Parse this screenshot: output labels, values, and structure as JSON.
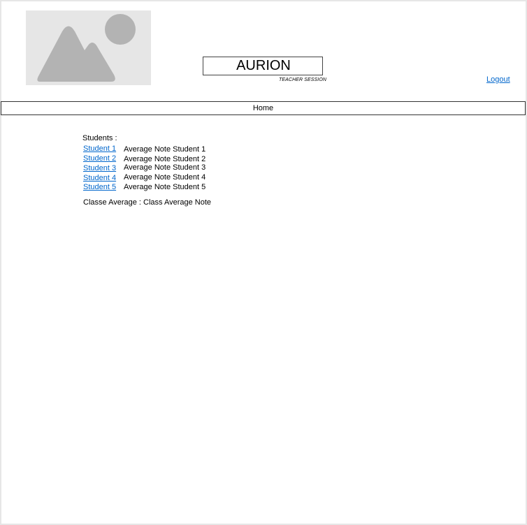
{
  "header": {
    "title": "AURION",
    "session_label": "TEACHER SESSION",
    "logout_label": "Logout"
  },
  "nav": {
    "home_label": "Home"
  },
  "main": {
    "students_label": "Students :",
    "students": [
      {
        "name": "Student 1",
        "average": "Average Note Student 1"
      },
      {
        "name": "Student 2",
        "average": "Average Note Student 2"
      },
      {
        "name": "Student 3",
        "average": "Average Note Student 3"
      },
      {
        "name": "Student 4",
        "average": "Average Note Student 4"
      },
      {
        "name": "Student 5",
        "average": "Average Note Student 5"
      }
    ],
    "class_average": "Classe Average : Class Average Note"
  },
  "icons": {
    "logo": "image-placeholder-icon"
  },
  "colors": {
    "link": "#0066cc",
    "placeholder_bg": "#e6e6e6",
    "placeholder_fg": "#b3b3b3"
  }
}
